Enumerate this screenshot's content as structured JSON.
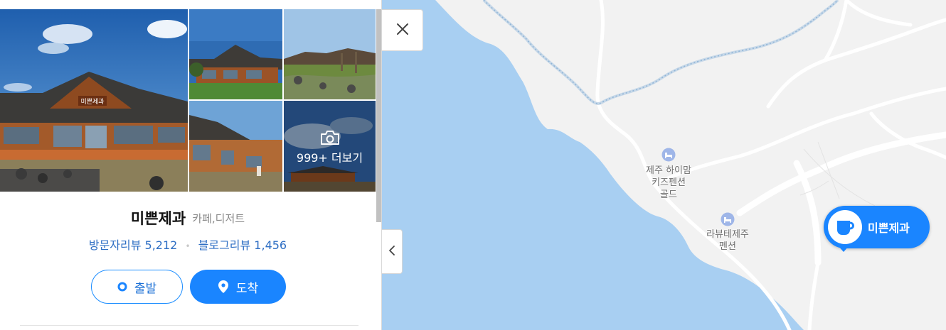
{
  "place": {
    "name": "미쁜제과",
    "category": "카페,디저트",
    "visitor_reviews_label": "방문자리뷰 5,212",
    "blog_reviews_label": "블로그리뷰 1,456"
  },
  "photos": {
    "more_label": "999+ 더보기",
    "sign_text": "미쁜제과"
  },
  "buttons": {
    "depart_label": "출발",
    "arrive_label": "도착"
  },
  "map": {
    "poi_1": [
      "제주 하이맘",
      "키즈펜션",
      "골드"
    ],
    "poi_2": [
      "라뷰테제주",
      "펜션"
    ],
    "marker_label": "미쁜제과"
  },
  "icons": {
    "close": "close-icon",
    "collapse": "chevron-left-icon",
    "camera": "camera-icon",
    "depart": "origin-dot-icon",
    "arrive": "location-pin-icon",
    "poi": "lodging-icon",
    "marker": "cafe-cup-icon"
  },
  "colors": {
    "accent": "#1a85ff",
    "sea": "#a8cff2",
    "land": "#f2f2f2",
    "review_text": "#2f6fc4",
    "poi_icon": "#9fb6e8"
  }
}
